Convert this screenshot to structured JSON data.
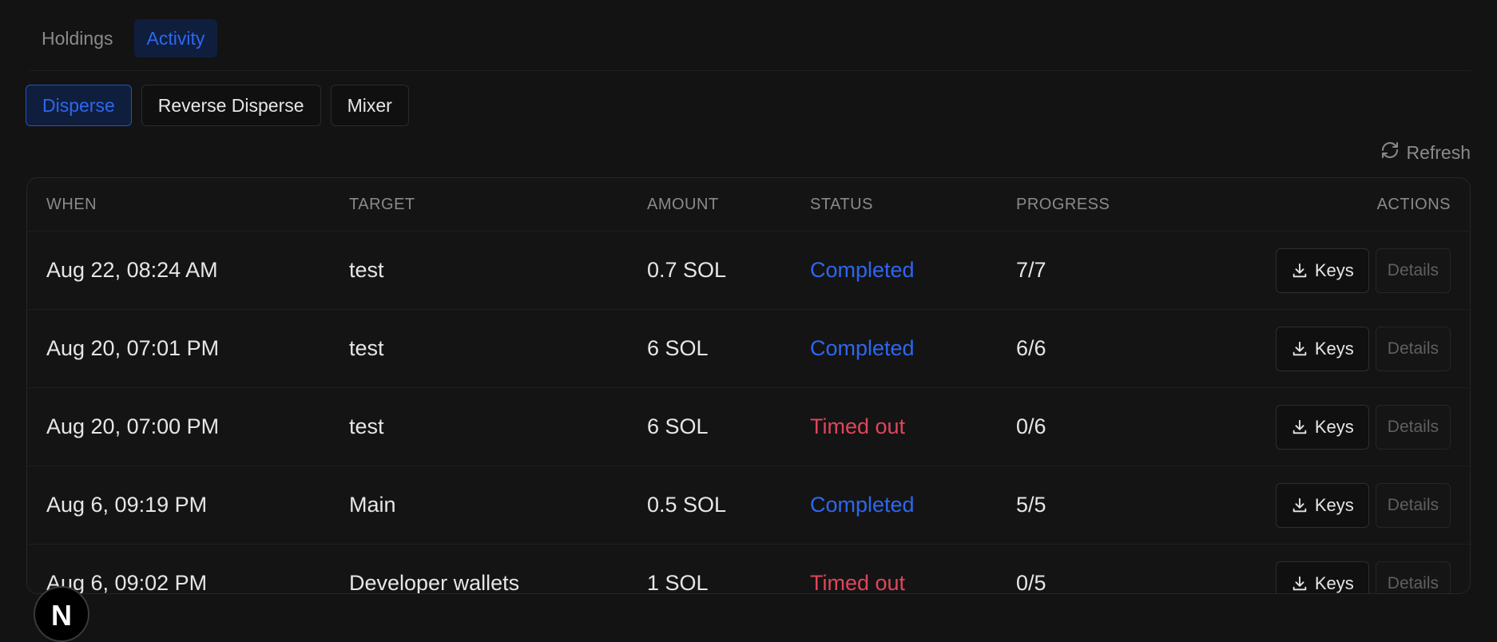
{
  "tabs": [
    {
      "label": "Holdings",
      "active": false
    },
    {
      "label": "Activity",
      "active": true
    }
  ],
  "subtabs": [
    {
      "label": "Disperse",
      "active": true
    },
    {
      "label": "Reverse Disperse",
      "active": false
    },
    {
      "label": "Mixer",
      "active": false
    }
  ],
  "refresh": {
    "label": "Refresh",
    "icon": "refresh-icon"
  },
  "table": {
    "columns": [
      "WHEN",
      "TARGET",
      "AMOUNT",
      "STATUS",
      "PROGRESS",
      "ACTIONS"
    ],
    "rows": [
      {
        "when": "Aug 22, 08:24 AM",
        "target": "test",
        "amount": "0.7 SOL",
        "status": "Completed",
        "progress": "7/7"
      },
      {
        "when": "Aug 20, 07:01 PM",
        "target": "test",
        "amount": "6 SOL",
        "status": "Completed",
        "progress": "6/6"
      },
      {
        "when": "Aug 20, 07:00 PM",
        "target": "test",
        "amount": "6 SOL",
        "status": "Timed out",
        "progress": "0/6"
      },
      {
        "when": "Aug 6, 09:19 PM",
        "target": "Main",
        "amount": "0.5 SOL",
        "status": "Completed",
        "progress": "5/5"
      },
      {
        "when": "Aug 6, 09:02 PM",
        "target": "Developer wallets",
        "amount": "1 SOL",
        "status": "Timed out",
        "progress": "0/5"
      }
    ],
    "actions": {
      "keys_label": "Keys",
      "details_label": "Details",
      "keys_icon": "download-icon"
    }
  },
  "colors": {
    "accent": "#2d67f0",
    "completed": "#2d67f0",
    "timed_out": "#e0455b"
  },
  "badge": {
    "letter": "N"
  }
}
